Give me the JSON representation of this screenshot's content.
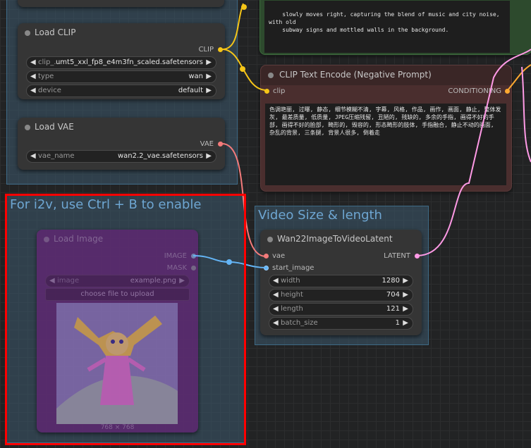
{
  "colors": {
    "clip_wire": "#f5c518",
    "vae_wire": "#f47b7b",
    "latent_wire": "#ff9ae6",
    "image_wire": "#64b5f6",
    "conditioning_pin": "#ffa931",
    "highlight": "#ff0000"
  },
  "top_text": {
    "line1": "slowly moves right, capturing the blend of music and city noise, with old",
    "line2": "subway signs and mottled walls in the background."
  },
  "load_clip": {
    "title": "Load CLIP",
    "output": "CLIP",
    "widgets": [
      {
        "label": "clip_...",
        "value": "umt5_xxl_fp8_e4m3fn_scaled.safetensors"
      },
      {
        "label": "type",
        "value": "wan"
      },
      {
        "label": "device",
        "value": "default"
      }
    ]
  },
  "load_vae": {
    "title": "Load VAE",
    "output": "VAE",
    "widget": {
      "label": "vae_name",
      "value": "wan2.2_vae.safetensors"
    }
  },
  "clip_neg": {
    "title": "CLIP Text Encode (Negative Prompt)",
    "input": "clip",
    "output": "CONDITIONING",
    "text": "色调艳丽, 过曝, 静态, 细节模糊不清, 字幕, 风格, 作品, 画作, 画面, 静止, 整体发灰, 最差质量, 低质量, JPEG压缩残留, 丑陋的, 残缺的, 多余的手指, 画得不好的手部, 画得不好的脸部, 畸形的, 毁容的, 形态畸形的肢体, 手指融合, 静止不动的画面, 杂乱的背景, 三条腿, 背景人很多, 倒着走"
  },
  "i2v_group": {
    "title": "For i2v, use Ctrl + B to enable"
  },
  "load_image": {
    "title": "Load Image",
    "outputs": [
      "IMAGE",
      "MASK"
    ],
    "widget": {
      "label": "image",
      "value": "example.png"
    },
    "upload": "choose file to upload",
    "size": "768 × 768"
  },
  "video_group": {
    "title": "Video Size & length"
  },
  "wan_node": {
    "title": "Wan22ImageToVideoLatent",
    "inputs": [
      "vae",
      "start_image"
    ],
    "output": "LATENT",
    "widgets": [
      {
        "label": "width",
        "value": "1280"
      },
      {
        "label": "height",
        "value": "704"
      },
      {
        "label": "length",
        "value": "121"
      },
      {
        "label": "batch_size",
        "value": "1"
      }
    ]
  }
}
